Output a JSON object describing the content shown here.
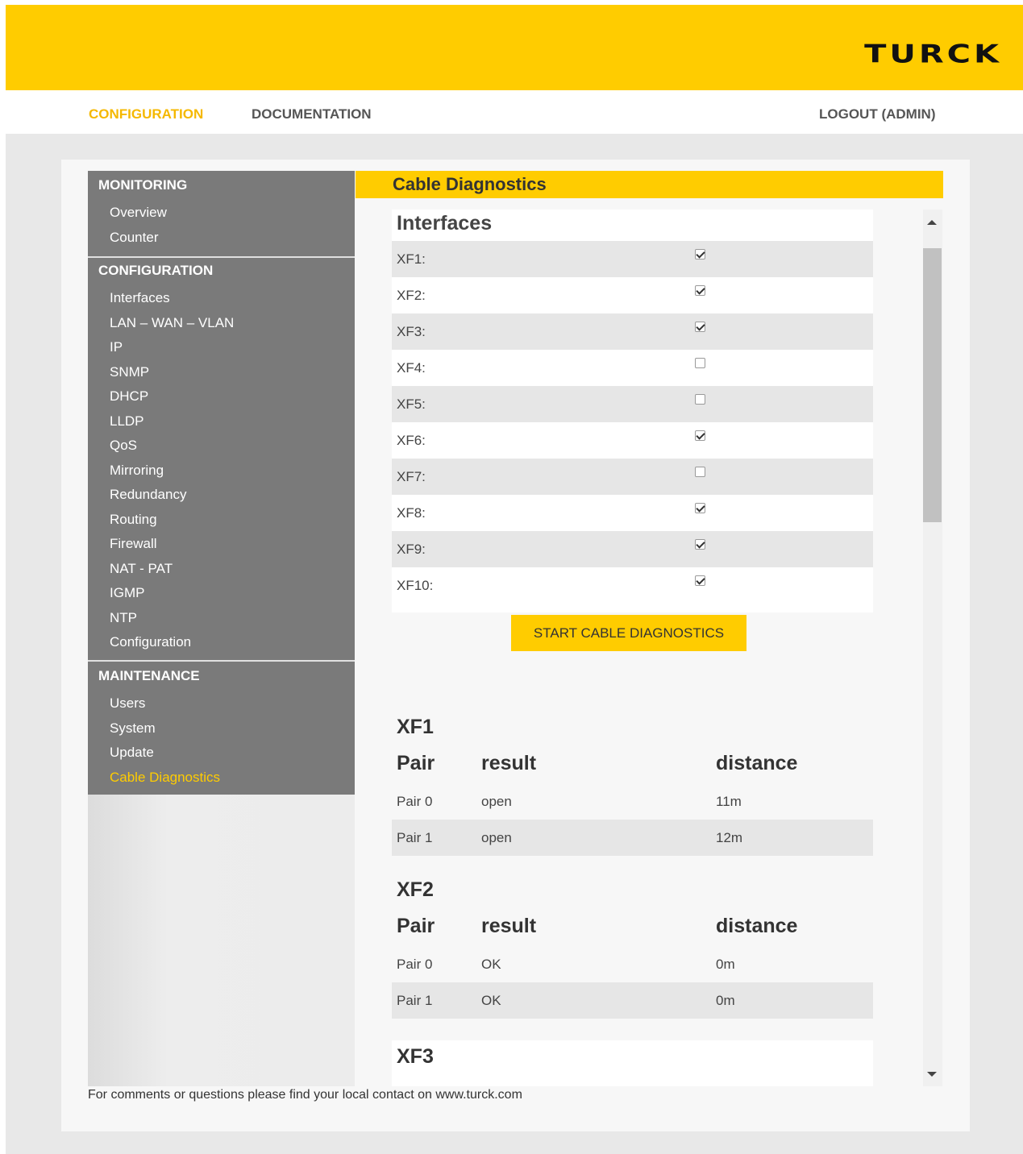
{
  "brand": {
    "logo": "TURCK"
  },
  "topnav": {
    "configuration": "CONFIGURATION",
    "documentation": "DOCUMENTATION",
    "logout": "LOGOUT (ADMIN)"
  },
  "sidebar": {
    "monitoring": {
      "title": "MONITORING",
      "items": [
        "Overview",
        "Counter"
      ]
    },
    "configuration": {
      "title": "CONFIGURATION",
      "items": [
        "Interfaces",
        "LAN – WAN – VLAN",
        "IP",
        "SNMP",
        "DHCP",
        "LLDP",
        "QoS",
        "Mirroring",
        "Redundancy",
        "Routing",
        "Firewall",
        "NAT - PAT",
        "IGMP",
        "NTP",
        "Configuration"
      ]
    },
    "maintenance": {
      "title": "MAINTENANCE",
      "items": [
        "Users",
        "System",
        "Update",
        "Cable Diagnostics"
      ],
      "active": "Cable Diagnostics"
    }
  },
  "main": {
    "title": "Cable Diagnostics",
    "interfaces_title": "Interfaces",
    "interfaces": [
      {
        "label": "XF1:",
        "checked": true
      },
      {
        "label": "XF2:",
        "checked": true
      },
      {
        "label": "XF3:",
        "checked": true
      },
      {
        "label": "XF4:",
        "checked": false
      },
      {
        "label": "XF5:",
        "checked": false
      },
      {
        "label": "XF6:",
        "checked": true
      },
      {
        "label": "XF7:",
        "checked": false
      },
      {
        "label": "XF8:",
        "checked": true
      },
      {
        "label": "XF9:",
        "checked": true
      },
      {
        "label": "XF10:",
        "checked": true
      }
    ],
    "start_button": "START CABLE DIAGNOSTICS",
    "headers": {
      "pair": "Pair",
      "result": "result",
      "distance": "distance"
    },
    "results": [
      {
        "name": "XF1",
        "rows": [
          {
            "pair": "Pair 0",
            "result": "open",
            "distance": "11m"
          },
          {
            "pair": "Pair 1",
            "result": "open",
            "distance": "12m"
          }
        ]
      },
      {
        "name": "XF2",
        "rows": [
          {
            "pair": "Pair 0",
            "result": "OK",
            "distance": "0m"
          },
          {
            "pair": "Pair 1",
            "result": "OK",
            "distance": "0m"
          }
        ]
      },
      {
        "name": "XF3",
        "rows": []
      }
    ]
  },
  "footer": "For comments or questions please find your local contact on www.turck.com",
  "colors": {
    "accent": "#ffcc00",
    "sidebar": "#7a7a7a",
    "active_nav": "#f5b800"
  }
}
